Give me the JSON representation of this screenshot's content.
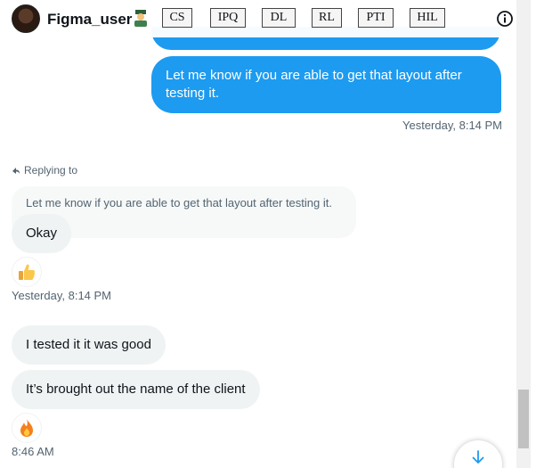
{
  "header": {
    "username": "Figma_user",
    "badge_icon": "person-badge-icon",
    "tags": [
      "CS",
      "IPQ",
      "DL",
      "RL",
      "PTI",
      "HIL"
    ],
    "info_icon": "info-icon"
  },
  "messages": {
    "outgoing_text": "Let me know if you are able to get that layout after testing it.",
    "outgoing_time": "Yesterday, 8:14 PM",
    "replying_label": "Replying to",
    "quoted_text": "Let me know if you are able to get that layout after testing it.",
    "reply_text": "Okay",
    "reply_reaction": "thumbs-up-emoji",
    "reply_time": "Yesterday, 8:14 PM",
    "msg1": "I tested it it was good",
    "msg2": "It’s brought out the name of the client",
    "msg2_reaction": "fire-emoji",
    "msg_time": "8:46 AM"
  },
  "colors": {
    "accent": "#1d9bf0",
    "incoming_bubble": "#eff3f4",
    "muted_text": "#536471"
  }
}
